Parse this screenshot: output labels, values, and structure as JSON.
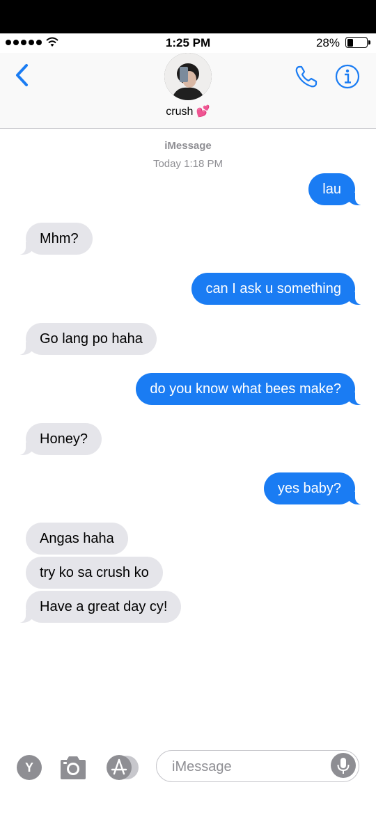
{
  "status_bar": {
    "time": "1:25 PM",
    "battery": "28%",
    "battery_level": 0.28
  },
  "header": {
    "contact_name": "crush 💕",
    "icons": [
      "back-chevron-icon",
      "phone-icon",
      "info-icon"
    ]
  },
  "thread": {
    "service": "iMessage",
    "timestamp": "Today 1:18 PM",
    "messages": [
      {
        "from": "me",
        "text": "lau"
      },
      {
        "from": "them",
        "text": "Mhm?"
      },
      {
        "from": "me",
        "text": "can I ask u something"
      },
      {
        "from": "them",
        "text": "Go lang po haha"
      },
      {
        "from": "me",
        "text": "do you know what bees make?"
      },
      {
        "from": "them",
        "text": "Honey?"
      },
      {
        "from": "me",
        "text": "yes baby?"
      },
      {
        "from": "them",
        "text": "Angas haha"
      },
      {
        "from": "them",
        "text": "try ko sa crush ko"
      },
      {
        "from": "them",
        "text": "Have a great day cy!"
      }
    ]
  },
  "composer": {
    "app_button_letter": "Y",
    "placeholder": "iMessage",
    "icons": [
      "y-app-icon",
      "camera-icon",
      "app-store-icon",
      "microphone-icon"
    ]
  },
  "colors": {
    "accent": "#1a7cf3",
    "received_bubble": "#e5e5ea",
    "meta_text": "#8e8e93"
  }
}
